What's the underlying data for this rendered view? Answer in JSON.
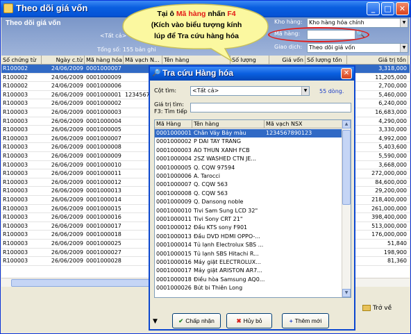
{
  "window": {
    "title": "Theo dõi giá vốn",
    "min": "_",
    "max": "□",
    "close": "✕"
  },
  "header": {
    "subtitle": "Theo dõi giá vốn",
    "all_label": "<Tất cả>",
    "total_label": "Tổng số: 155 bản ghi",
    "kho_label": "Kho hàng:",
    "kho_value": "Kho hàng hóa chính",
    "mahang_label": "Mã hàng:",
    "mahang_value": "",
    "giaodich_label": "Giao dịch:",
    "giaodich_value": "Theo dõi giá vốn"
  },
  "callout": {
    "line1_a": "Tại ô ",
    "line1_b": "Mã hàng",
    "line1_c": " nhấn ",
    "line1_d": "F4",
    "line2": "(Kích vào biểu tượng kính",
    "line3": "lúp để Tra cứu hàng hóa"
  },
  "grid": {
    "columns": [
      "Số chứng từ",
      "Ngày c.từ",
      "Mã hàng hóa",
      "Mã vạch N...",
      "Tên hàng",
      "Số lượng",
      "Giá vốn",
      "Số lượng tồn",
      "Giá trị tồn"
    ],
    "rows": [
      {
        "so": "R100002",
        "ngay": "24/06/2009",
        "ma": "0001000007",
        "mavach": "",
        "gtt": "3,318,000",
        "sel": true
      },
      {
        "so": "R100002",
        "ngay": "24/06/2009",
        "ma": "0001000009",
        "mavach": "",
        "gtt": "11,205,000"
      },
      {
        "so": "R100002",
        "ngay": "24/06/2009",
        "ma": "0001000006",
        "mavach": "",
        "gtt": "2,700,000"
      },
      {
        "so": "R100003",
        "ngay": "26/06/2009",
        "ma": "0001000001",
        "mavach": "1234567",
        "gtt": "5,460,000"
      },
      {
        "so": "R100003",
        "ngay": "26/06/2009",
        "ma": "0001000002",
        "mavach": "",
        "gtt": "6,240,000"
      },
      {
        "so": "R100003",
        "ngay": "26/06/2009",
        "ma": "0001000003",
        "mavach": "",
        "gtt": "16,683,000"
      },
      {
        "so": "R100003",
        "ngay": "26/06/2009",
        "ma": "0001000004",
        "mavach": "",
        "gtt": "4,290,000"
      },
      {
        "so": "R100003",
        "ngay": "26/06/2009",
        "ma": "0001000005",
        "mavach": "",
        "gtt": "3,330,000"
      },
      {
        "so": "R100003",
        "ngay": "26/06/2009",
        "ma": "0001000007",
        "mavach": "",
        "gtt": "4,992,000"
      },
      {
        "so": "R100003",
        "ngay": "26/06/2009",
        "ma": "0001000008",
        "mavach": "",
        "gtt": "5,403,600"
      },
      {
        "so": "R100003",
        "ngay": "26/06/2009",
        "ma": "0001000009",
        "mavach": "",
        "gtt": "5,590,000"
      },
      {
        "so": "R100003",
        "ngay": "26/06/2009",
        "ma": "0001000010",
        "mavach": "",
        "gtt": "3,668,000"
      },
      {
        "so": "R100003",
        "ngay": "26/06/2009",
        "ma": "0001000011",
        "mavach": "",
        "gtt": "272,000,000"
      },
      {
        "so": "R100003",
        "ngay": "26/06/2009",
        "ma": "0001000012",
        "mavach": "",
        "gtt": "84,600,000"
      },
      {
        "so": "R100003",
        "ngay": "26/06/2009",
        "ma": "0001000013",
        "mavach": "",
        "gtt": "29,200,000"
      },
      {
        "so": "R100003",
        "ngay": "26/06/2009",
        "ma": "0001000014",
        "mavach": "",
        "gtt": "218,400,000"
      },
      {
        "so": "R100003",
        "ngay": "26/06/2009",
        "ma": "0001000015",
        "mavach": "",
        "gtt": "261,000,000"
      },
      {
        "so": "R100003",
        "ngay": "26/06/2009",
        "ma": "0001000016",
        "mavach": "",
        "gtt": "398,400,000"
      },
      {
        "so": "R100003",
        "ngay": "26/06/2009",
        "ma": "0001000017",
        "mavach": "",
        "gtt": "513,000,000"
      },
      {
        "so": "R100003",
        "ngay": "26/06/2009",
        "ma": "0001000018",
        "mavach": "",
        "gtt": "176,000,000"
      },
      {
        "so": "R100003",
        "ngay": "26/06/2009",
        "ma": "0001000025",
        "mavach": "",
        "gtt": "51,840"
      },
      {
        "so": "R100003",
        "ngay": "26/06/2009",
        "ma": "0001000027",
        "mavach": "",
        "gtt": "198,900"
      },
      {
        "so": "R100003",
        "ngay": "26/06/2009",
        "ma": "0001000028",
        "mavach": "",
        "gtt": "81,360"
      }
    ]
  },
  "back_button": "Trở về",
  "dialog": {
    "title": "Tra cứu Hàng hóa",
    "close": "✕",
    "cot_tim_label": "Cột tìm:",
    "cot_tim_value": "<Tất cả>",
    "count": "55 dòng.",
    "gia_tri_label": "Giá trị tìm:",
    "f3_label": "F3: Tìm tiếp",
    "gia_tri_value": "",
    "columns": [
      "Mã Hàng",
      "Tên hàng",
      "Mã vạch NSX"
    ],
    "rows": [
      {
        "ma": "0001000001",
        "ten": "Chân Váy Bảy màu",
        "nsx": "1234567890123",
        "sel": true
      },
      {
        "ma": "0001000002",
        "ten": "P DAI TAY TRANG",
        "nsx": ""
      },
      {
        "ma": "0001000003",
        "ten": "AO THUN XANH FCB",
        "nsx": ""
      },
      {
        "ma": "0001000004",
        "ten": "2SZ WASHED CTN JE...",
        "nsx": ""
      },
      {
        "ma": "0001000005",
        "ten": "Q. CQW 97594",
        "nsx": ""
      },
      {
        "ma": "0001000006",
        "ten": "A. Tarocci",
        "nsx": ""
      },
      {
        "ma": "0001000007",
        "ten": "Q. CQW 563",
        "nsx": ""
      },
      {
        "ma": "0001000008",
        "ten": "Q. CQW 563",
        "nsx": ""
      },
      {
        "ma": "0001000009",
        "ten": "Q. Dansong noble",
        "nsx": ""
      },
      {
        "ma": "0001000010",
        "ten": "Tivi Sam Sung LCD 32\"",
        "nsx": ""
      },
      {
        "ma": "0001000011",
        "ten": "Tivi Sony CRT 21\"",
        "nsx": ""
      },
      {
        "ma": "0001000012",
        "ten": "Đầu KTS sony F901",
        "nsx": ""
      },
      {
        "ma": "0001000013",
        "ten": "Đầu DVD HDMI OPPO-...",
        "nsx": ""
      },
      {
        "ma": "0001000014",
        "ten": "Tủ lạnh Electrolux SBS ...",
        "nsx": ""
      },
      {
        "ma": "0001000015",
        "ten": "Tủ lạnh SBS Hitachi R...",
        "nsx": ""
      },
      {
        "ma": "0001000016",
        "ten": "Máy giặt ELECTROLUX...",
        "nsx": ""
      },
      {
        "ma": "0001000017",
        "ten": "Máy giặt ARISTON AR7...",
        "nsx": ""
      },
      {
        "ma": "0001000018",
        "ten": "Điều hòa Samsung AQ0...",
        "nsx": ""
      },
      {
        "ma": "0001000026",
        "ten": "Bút bi Thiên Long",
        "nsx": ""
      }
    ],
    "btn_accept": "Chấp nhận",
    "btn_cancel": "Hủy bỏ",
    "btn_new": "Thêm mới",
    "filter_icon": "▼"
  }
}
